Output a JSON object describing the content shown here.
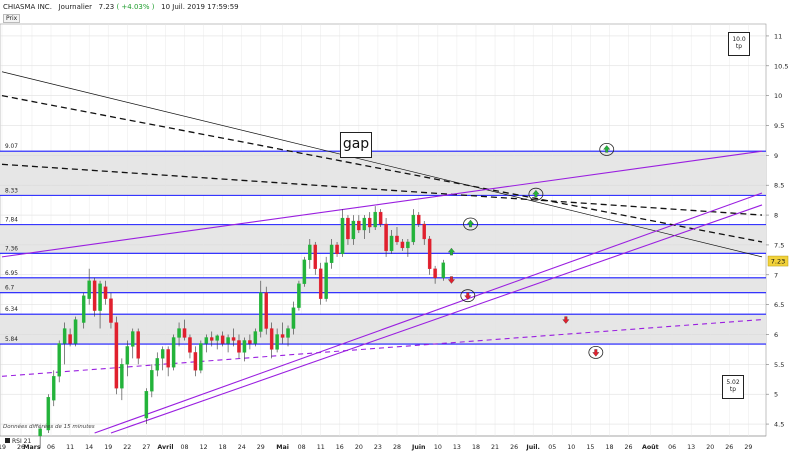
{
  "header": {
    "name": "CHIASMA INC.",
    "period": "Journalier",
    "price": "7.23",
    "change": "( +4.03% )",
    "datetime": "10 Juil. 2019 17:59:59"
  },
  "price_tab": "Prix",
  "footnote": "Données différées de 15 minutes",
  "rsi_label": "RSI 21",
  "annotations": {
    "gap": "gap",
    "box_top": [
      "10.0",
      "tp"
    ],
    "box_bottom": [
      "5.02",
      "tp"
    ]
  },
  "colors": {
    "up": "#23b33a",
    "down": "#e0202e",
    "support": "#1a1aff",
    "channel": "#9a1fe0",
    "trend": "#111111",
    "band": "#e6e6e6",
    "price_badge": "#f2d23a"
  },
  "chart_data": {
    "type": "candlestick",
    "ylim": [
      4.3,
      11.2
    ],
    "yticks": [
      "11",
      "10.5",
      "10",
      "9.5",
      "9",
      "8.5",
      "8",
      "7.5",
      "7",
      "6.5",
      "6",
      "5.5",
      "5",
      "4.5"
    ],
    "last_price": "7.23",
    "horizontal_levels": [
      {
        "value": 9.07,
        "label": "9.07"
      },
      {
        "value": 8.33,
        "label": "8.33"
      },
      {
        "value": 7.84,
        "label": "7.84"
      },
      {
        "value": 7.36,
        "label": "7.36"
      },
      {
        "value": 6.95,
        "label": "6.95"
      },
      {
        "value": 6.7,
        "label": "6.7"
      },
      {
        "value": 6.34,
        "label": "6.34"
      },
      {
        "value": 5.84,
        "label": "5.84"
      }
    ],
    "x_ticks": [
      {
        "day": 0,
        "label": "19"
      },
      {
        "day": 7,
        "label": "26"
      },
      {
        "day": 11,
        "label": "Mars"
      },
      {
        "day": 18,
        "label": "06"
      },
      {
        "day": 25,
        "label": "11"
      },
      {
        "day": 32,
        "label": "14"
      },
      {
        "day": 39,
        "label": "19"
      },
      {
        "day": 46,
        "label": "22"
      },
      {
        "day": 53,
        "label": "27"
      },
      {
        "day": 60,
        "label": "Avril"
      },
      {
        "day": 67,
        "label": "08"
      },
      {
        "day": 74,
        "label": "12"
      },
      {
        "day": 81,
        "label": "18"
      },
      {
        "day": 88,
        "label": "24"
      },
      {
        "day": 95,
        "label": "29"
      },
      {
        "day": 103,
        "label": "Mai"
      },
      {
        "day": 110,
        "label": "08"
      },
      {
        "day": 117,
        "label": "11"
      },
      {
        "day": 124,
        "label": "16"
      },
      {
        "day": 131,
        "label": "20"
      },
      {
        "day": 138,
        "label": "23"
      },
      {
        "day": 145,
        "label": "28"
      },
      {
        "day": 153,
        "label": "Juin"
      },
      {
        "day": 160,
        "label": "10"
      },
      {
        "day": 167,
        "label": "13"
      },
      {
        "day": 174,
        "label": "18"
      },
      {
        "day": 181,
        "label": "21"
      },
      {
        "day": 188,
        "label": "26"
      },
      {
        "day": 195,
        "label": "Juil."
      },
      {
        "day": 202,
        "label": "05"
      },
      {
        "day": 209,
        "label": "10"
      },
      {
        "day": 216,
        "label": "15"
      },
      {
        "day": 223,
        "label": "18"
      },
      {
        "day": 230,
        "label": "26"
      },
      {
        "day": 238,
        "label": "Août"
      },
      {
        "day": 246,
        "label": "06"
      },
      {
        "day": 253,
        "label": "13"
      },
      {
        "day": 260,
        "label": "20"
      },
      {
        "day": 267,
        "label": "26"
      },
      {
        "day": 274,
        "label": "29"
      }
    ],
    "x_range": [
      0,
      279
    ],
    "candles": [
      {
        "day": 14,
        "o": 4.3,
        "h": 4.45,
        "l": 4.1,
        "c": 4.42
      },
      {
        "day": 17,
        "o": 4.4,
        "h": 5.0,
        "l": 4.35,
        "c": 4.95
      },
      {
        "day": 19,
        "o": 4.9,
        "h": 5.4,
        "l": 4.8,
        "c": 5.3
      },
      {
        "day": 21,
        "o": 5.3,
        "h": 5.9,
        "l": 5.2,
        "c": 5.85
      },
      {
        "day": 23,
        "o": 5.85,
        "h": 6.2,
        "l": 5.5,
        "c": 6.1
      },
      {
        "day": 25,
        "o": 6.0,
        "h": 6.1,
        "l": 5.8,
        "c": 5.85
      },
      {
        "day": 27,
        "o": 5.85,
        "h": 6.3,
        "l": 5.8,
        "c": 6.25
      },
      {
        "day": 30,
        "o": 6.2,
        "h": 6.7,
        "l": 6.1,
        "c": 6.65
      },
      {
        "day": 32,
        "o": 6.6,
        "h": 7.1,
        "l": 6.5,
        "c": 6.9
      },
      {
        "day": 34,
        "o": 6.9,
        "h": 6.95,
        "l": 6.3,
        "c": 6.4
      },
      {
        "day": 36,
        "o": 6.4,
        "h": 6.9,
        "l": 6.1,
        "c": 6.85
      },
      {
        "day": 38,
        "o": 6.8,
        "h": 6.9,
        "l": 6.5,
        "c": 6.6
      },
      {
        "day": 40,
        "o": 6.6,
        "h": 6.7,
        "l": 6.1,
        "c": 6.2
      },
      {
        "day": 42,
        "o": 6.2,
        "h": 6.3,
        "l": 5.0,
        "c": 5.1
      },
      {
        "day": 44,
        "o": 5.1,
        "h": 5.6,
        "l": 4.9,
        "c": 5.5
      },
      {
        "day": 46,
        "o": 5.5,
        "h": 5.9,
        "l": 5.3,
        "c": 5.8
      },
      {
        "day": 48,
        "o": 5.8,
        "h": 6.1,
        "l": 5.6,
        "c": 6.05
      },
      {
        "day": 50,
        "o": 6.05,
        "h": 6.1,
        "l": 5.5,
        "c": 5.6
      },
      {
        "day": 53,
        "o": 4.6,
        "h": 5.1,
        "l": 4.5,
        "c": 5.05
      },
      {
        "day": 55,
        "o": 5.05,
        "h": 5.5,
        "l": 4.95,
        "c": 5.4
      },
      {
        "day": 57,
        "o": 5.4,
        "h": 5.7,
        "l": 5.3,
        "c": 5.6
      },
      {
        "day": 59,
        "o": 5.6,
        "h": 5.8,
        "l": 5.4,
        "c": 5.75
      },
      {
        "day": 61,
        "o": 5.75,
        "h": 5.8,
        "l": 5.3,
        "c": 5.45
      },
      {
        "day": 63,
        "o": 5.45,
        "h": 6.0,
        "l": 5.4,
        "c": 5.95
      },
      {
        "day": 65,
        "o": 5.95,
        "h": 6.2,
        "l": 5.8,
        "c": 6.1
      },
      {
        "day": 67,
        "o": 6.1,
        "h": 6.25,
        "l": 5.9,
        "c": 5.95
      },
      {
        "day": 69,
        "o": 5.95,
        "h": 6.0,
        "l": 5.6,
        "c": 5.7
      },
      {
        "day": 71,
        "o": 5.7,
        "h": 5.8,
        "l": 5.3,
        "c": 5.4
      },
      {
        "day": 73,
        "o": 5.4,
        "h": 5.9,
        "l": 5.35,
        "c": 5.85
      },
      {
        "day": 75,
        "o": 5.85,
        "h": 6.0,
        "l": 5.7,
        "c": 5.95
      },
      {
        "day": 77,
        "o": 5.95,
        "h": 6.05,
        "l": 5.8,
        "c": 5.9
      },
      {
        "day": 79,
        "o": 5.9,
        "h": 6.0,
        "l": 5.75,
        "c": 5.98
      },
      {
        "day": 81,
        "o": 5.98,
        "h": 6.05,
        "l": 5.8,
        "c": 5.85
      },
      {
        "day": 83,
        "o": 5.85,
        "h": 6.0,
        "l": 5.7,
        "c": 5.95
      },
      {
        "day": 85,
        "o": 5.95,
        "h": 6.1,
        "l": 5.8,
        "c": 5.9
      },
      {
        "day": 87,
        "o": 5.9,
        "h": 6.0,
        "l": 5.6,
        "c": 5.7
      },
      {
        "day": 89,
        "o": 5.7,
        "h": 5.95,
        "l": 5.55,
        "c": 5.9
      },
      {
        "day": 91,
        "o": 5.9,
        "h": 6.0,
        "l": 5.75,
        "c": 5.85
      },
      {
        "day": 93,
        "o": 5.85,
        "h": 6.1,
        "l": 5.8,
        "c": 6.05
      },
      {
        "day": 95,
        "o": 6.05,
        "h": 6.9,
        "l": 5.95,
        "c": 6.7
      },
      {
        "day": 97,
        "o": 6.7,
        "h": 6.8,
        "l": 6.0,
        "c": 6.1
      },
      {
        "day": 99,
        "o": 6.1,
        "h": 6.2,
        "l": 5.6,
        "c": 5.75
      },
      {
        "day": 101,
        "o": 5.75,
        "h": 6.1,
        "l": 5.7,
        "c": 6.0
      },
      {
        "day": 103,
        "o": 6.0,
        "h": 6.2,
        "l": 5.85,
        "c": 5.95
      },
      {
        "day": 105,
        "o": 5.95,
        "h": 6.15,
        "l": 5.8,
        "c": 6.1
      },
      {
        "day": 107,
        "o": 6.1,
        "h": 6.55,
        "l": 6.0,
        "c": 6.45
      },
      {
        "day": 109,
        "o": 6.45,
        "h": 6.9,
        "l": 6.4,
        "c": 6.85
      },
      {
        "day": 111,
        "o": 6.85,
        "h": 7.3,
        "l": 6.8,
        "c": 7.25
      },
      {
        "day": 113,
        "o": 7.25,
        "h": 7.6,
        "l": 7.1,
        "c": 7.5
      },
      {
        "day": 115,
        "o": 7.5,
        "h": 7.55,
        "l": 7.0,
        "c": 7.1
      },
      {
        "day": 117,
        "o": 7.1,
        "h": 7.2,
        "l": 6.5,
        "c": 6.6
      },
      {
        "day": 119,
        "o": 6.6,
        "h": 7.3,
        "l": 6.55,
        "c": 7.2
      },
      {
        "day": 121,
        "o": 7.2,
        "h": 7.6,
        "l": 7.1,
        "c": 7.5
      },
      {
        "day": 123,
        "o": 7.5,
        "h": 7.55,
        "l": 7.3,
        "c": 7.35
      },
      {
        "day": 125,
        "o": 7.35,
        "h": 8.1,
        "l": 7.3,
        "c": 7.95
      },
      {
        "day": 127,
        "o": 7.95,
        "h": 8.0,
        "l": 7.5,
        "c": 7.6
      },
      {
        "day": 129,
        "o": 7.6,
        "h": 8.0,
        "l": 7.5,
        "c": 7.9
      },
      {
        "day": 131,
        "o": 7.9,
        "h": 8.0,
        "l": 7.7,
        "c": 7.75
      },
      {
        "day": 133,
        "o": 7.75,
        "h": 8.0,
        "l": 7.6,
        "c": 7.95
      },
      {
        "day": 135,
        "o": 7.95,
        "h": 8.05,
        "l": 7.7,
        "c": 7.8
      },
      {
        "day": 137,
        "o": 7.8,
        "h": 8.15,
        "l": 7.75,
        "c": 8.05
      },
      {
        "day": 139,
        "o": 8.05,
        "h": 8.1,
        "l": 7.8,
        "c": 7.85
      },
      {
        "day": 141,
        "o": 7.85,
        "h": 7.95,
        "l": 7.3,
        "c": 7.4
      },
      {
        "day": 143,
        "o": 7.4,
        "h": 7.75,
        "l": 7.35,
        "c": 7.65
      },
      {
        "day": 145,
        "o": 7.65,
        "h": 7.8,
        "l": 7.5,
        "c": 7.55
      },
      {
        "day": 147,
        "o": 7.55,
        "h": 7.6,
        "l": 7.4,
        "c": 7.45
      },
      {
        "day": 149,
        "o": 7.45,
        "h": 7.6,
        "l": 7.3,
        "c": 7.55
      },
      {
        "day": 151,
        "o": 7.55,
        "h": 8.1,
        "l": 7.5,
        "c": 8.0
      },
      {
        "day": 153,
        "o": 8.0,
        "h": 8.05,
        "l": 7.8,
        "c": 7.85
      },
      {
        "day": 155,
        "o": 7.85,
        "h": 7.9,
        "l": 7.5,
        "c": 7.6
      },
      {
        "day": 157,
        "o": 7.6,
        "h": 7.65,
        "l": 7.0,
        "c": 7.1
      },
      {
        "day": 159,
        "o": 7.1,
        "h": 7.15,
        "l": 6.85,
        "c": 6.95
      },
      {
        "day": 162,
        "o": 6.95,
        "h": 7.25,
        "l": 6.9,
        "c": 7.2
      }
    ],
    "price_line": {
      "from": {
        "day": 1,
        "value": 5.3
      },
      "to": {
        "day": 279,
        "value": 6.25
      }
    },
    "trend_lines": [
      {
        "style": "solid",
        "color": "trend",
        "from": {
          "day": 0,
          "value": 10.4
        },
        "to": {
          "day": 279,
          "value": 7.3
        }
      },
      {
        "style": "dashed",
        "color": "trend",
        "from": {
          "day": 0,
          "value": 10.0
        },
        "to": {
          "day": 279,
          "value": 7.55
        }
      },
      {
        "style": "dashed",
        "color": "trend",
        "from": {
          "day": 0,
          "value": 8.85
        },
        "to": {
          "day": 279,
          "value": 8.0
        }
      }
    ],
    "channel_lines": [
      {
        "style": "solid",
        "from": {
          "day": 0,
          "value": 7.3
        },
        "to": {
          "day": 279,
          "value": 9.07
        }
      },
      {
        "style": "solid",
        "from": {
          "day": 34,
          "value": 4.35
        },
        "to": {
          "day": 279,
          "value": 8.37
        }
      },
      {
        "style": "solid",
        "from": {
          "day": 40,
          "value": 4.35
        },
        "to": {
          "day": 279,
          "value": 8.17
        }
      },
      {
        "style": "dashed",
        "from": {
          "day": 0,
          "value": 5.3
        },
        "to": {
          "day": 279,
          "value": 6.25
        }
      }
    ],
    "markers": [
      {
        "day": 165,
        "value": 7.38,
        "kind": "up-arrow",
        "ringed": false
      },
      {
        "day": 165,
        "value": 6.92,
        "kind": "down-arrow",
        "ringed": false
      },
      {
        "day": 171,
        "value": 6.65,
        "kind": "down-arrow",
        "ringed": true
      },
      {
        "day": 172,
        "value": 7.85,
        "kind": "up-arrow",
        "ringed": true
      },
      {
        "day": 196,
        "value": 8.35,
        "kind": "up-arrow",
        "ringed": true
      },
      {
        "day": 207,
        "value": 6.25,
        "kind": "down-arrow",
        "ringed": false
      },
      {
        "day": 218,
        "value": 5.7,
        "kind": "down-arrow",
        "ringed": true
      },
      {
        "day": 222,
        "value": 9.1,
        "kind": "up-arrow",
        "ringed": true
      }
    ]
  }
}
